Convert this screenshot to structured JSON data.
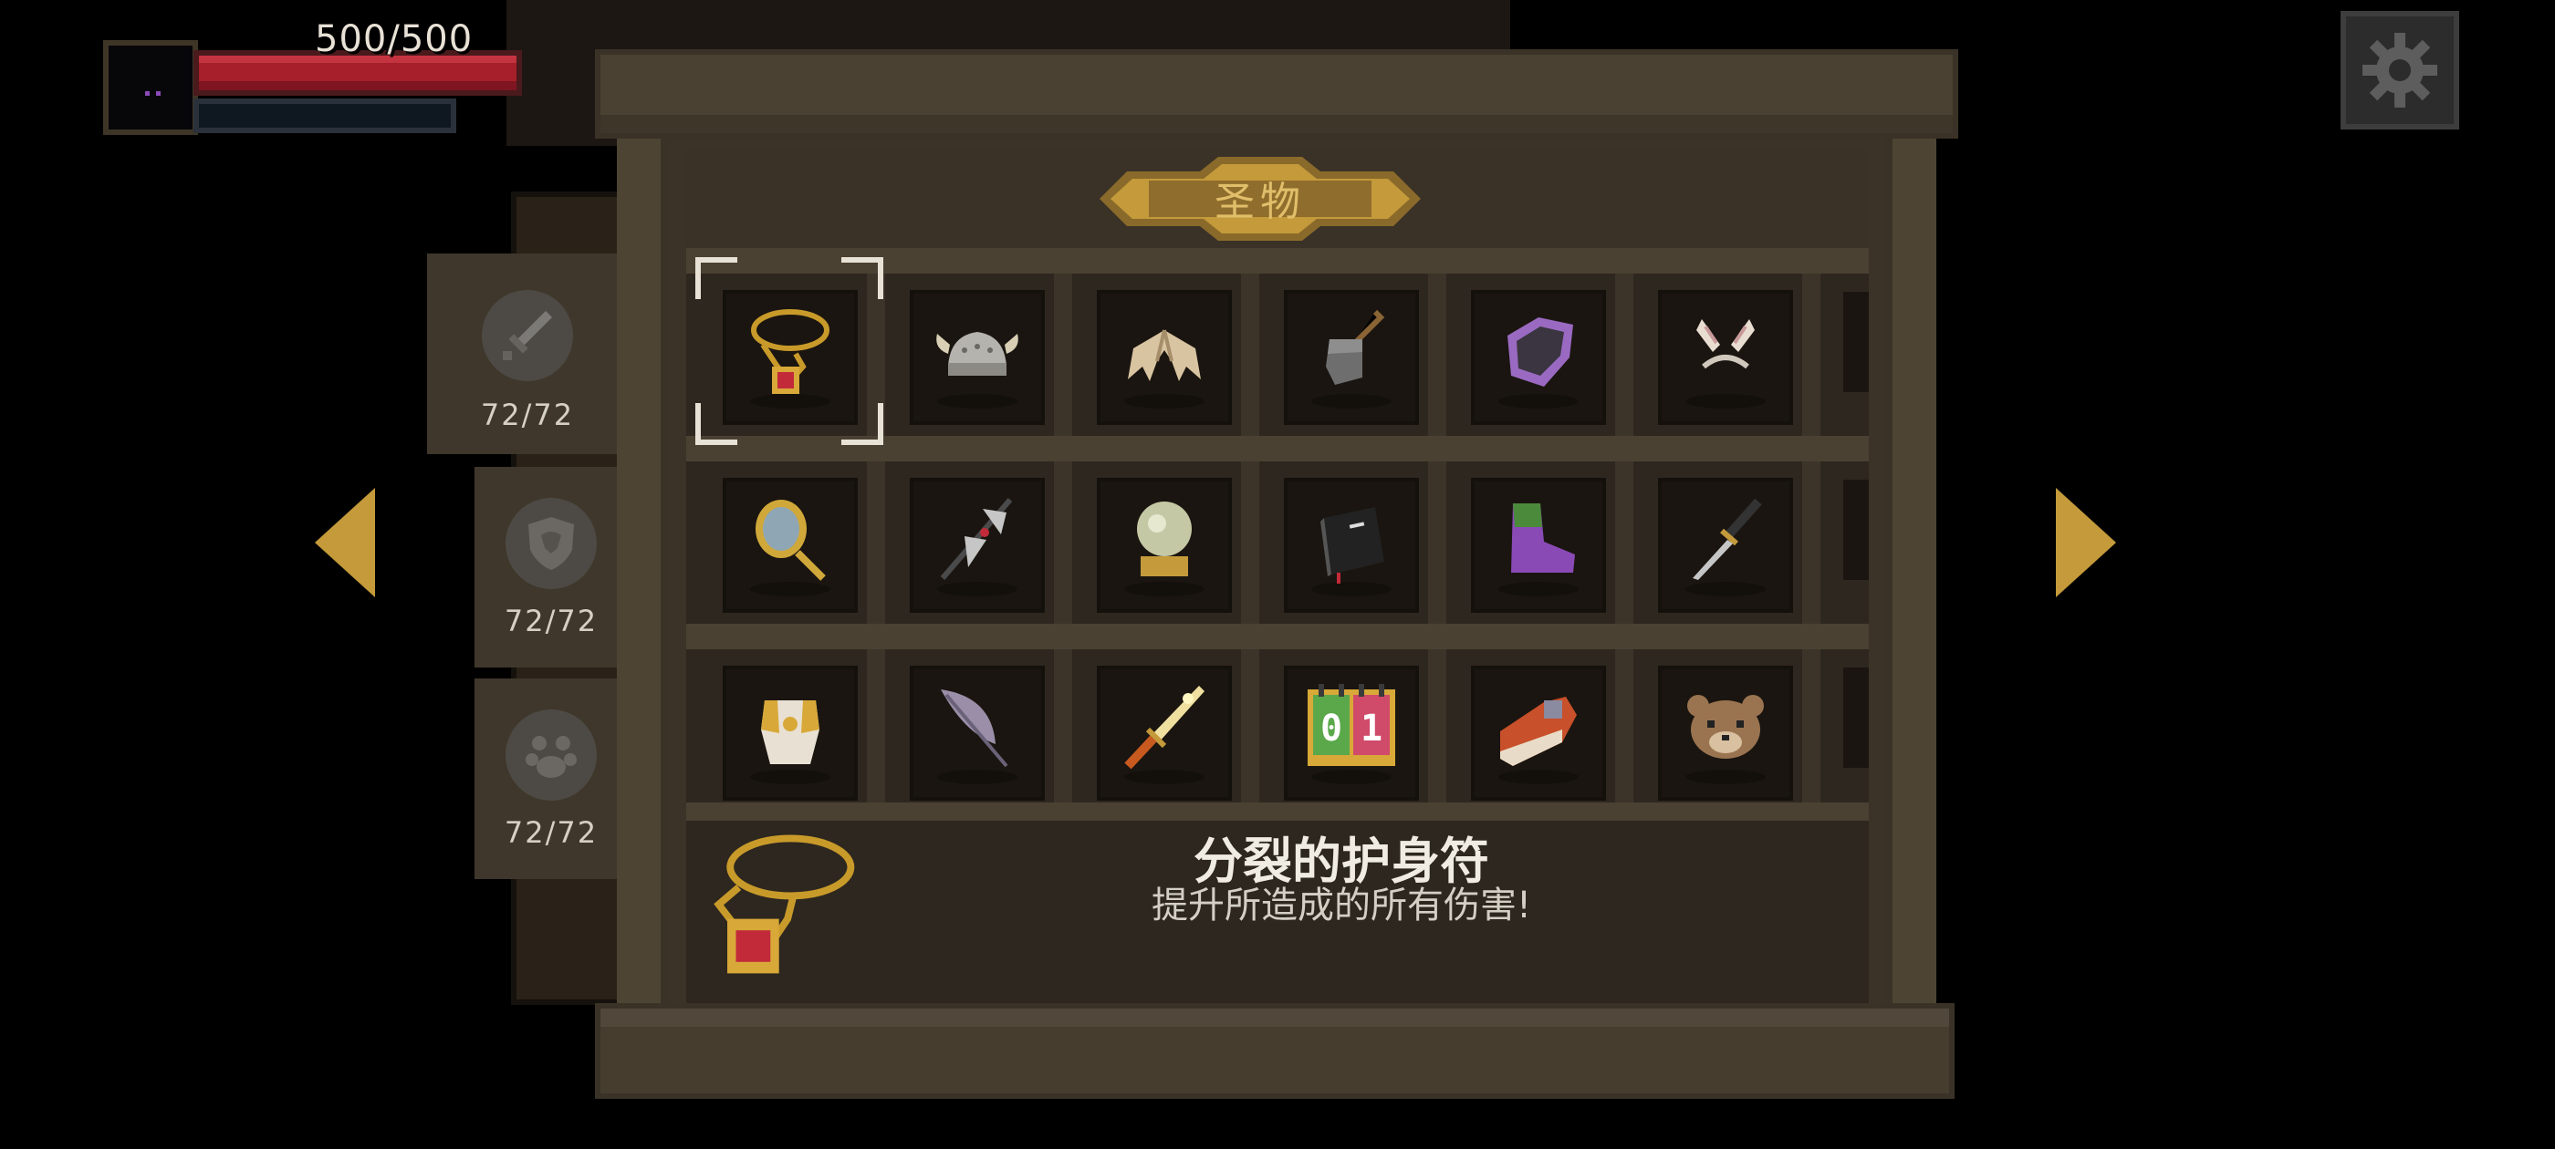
{
  "hud": {
    "hp_text": "500/500",
    "hp_color": "#a61f2a"
  },
  "settings": {
    "icon": "gear-icon"
  },
  "nav": {
    "prev_icon": "arrow-left-icon",
    "next_icon": "arrow-right-icon",
    "accent": "#c49a3b"
  },
  "side_tabs": [
    {
      "icon": "sword-icon",
      "count": "72/72"
    },
    {
      "icon": "shield-icon",
      "count": "72/72"
    },
    {
      "icon": "paw-icon",
      "count": "72/72"
    }
  ],
  "panel": {
    "title": "圣物",
    "rows": [
      [
        "amulet-icon",
        "viking-helmet-icon",
        "bone-wings-icon",
        "axe-head-icon",
        "purple-gauntlet-icon",
        "bunny-ears-icon"
      ],
      [
        "hand-mirror-icon",
        "battle-axe-icon",
        "crystal-orb-icon",
        "black-book-icon",
        "purple-boot-icon",
        "dagger-icon"
      ],
      [
        "gold-armor-icon",
        "feather-icon",
        "flaming-sword-icon",
        "calendar-counter-icon",
        "red-shoe-icon",
        "bear-mask-icon"
      ]
    ],
    "counter_digits": [
      "0",
      "1"
    ],
    "selected": {
      "name": "分裂的护身符",
      "description": "提升所造成的所有伤害!",
      "icon": "amulet-icon"
    }
  }
}
